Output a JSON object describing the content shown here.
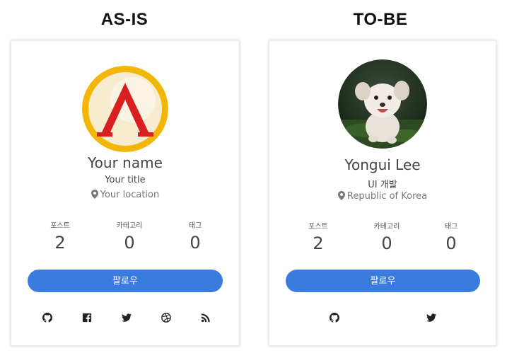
{
  "headings": {
    "left": "AS-IS",
    "right": "TO-BE"
  },
  "as_is": {
    "name": "Your name",
    "title": "Your title",
    "location": "Your location",
    "stats": [
      {
        "label": "포스트",
        "value": "2"
      },
      {
        "label": "카테고리",
        "value": "0"
      },
      {
        "label": "태그",
        "value": "0"
      }
    ],
    "follow_label": "팔로우",
    "social_icons": [
      "github-icon",
      "facebook-icon",
      "twitter-icon",
      "dribbble-icon",
      "rss-icon"
    ]
  },
  "to_be": {
    "name": "Yongui Lee",
    "title": "UI 개발",
    "location": "Republic of Korea",
    "stats": [
      {
        "label": "포스트",
        "value": "2"
      },
      {
        "label": "카테고리",
        "value": "0"
      },
      {
        "label": "태그",
        "value": "0"
      }
    ],
    "follow_label": "팔로우",
    "social_icons": [
      "github-icon",
      "twitter-icon"
    ]
  },
  "colors": {
    "follow_button": "#3a7bde",
    "logo_ring": "#f2b705",
    "logo_mark": "#d91f1f"
  }
}
